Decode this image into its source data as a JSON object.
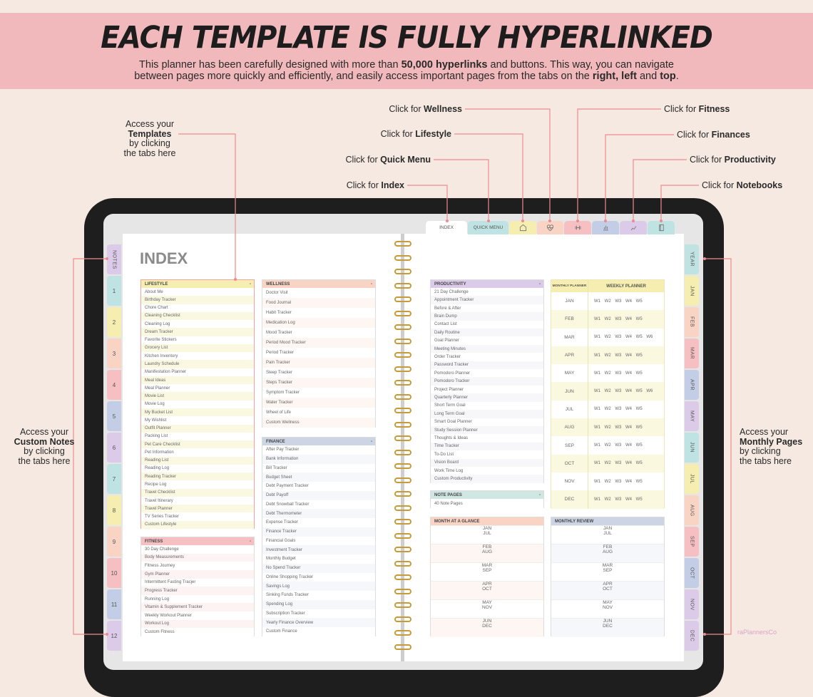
{
  "banner": {
    "title": "EACH TEMPLATE IS FULLY HYPERLINKED",
    "line1_a": "This planner has been carefully designed with more than ",
    "line1_b": "50,000 hyperlinks",
    "line1_c": " and buttons. This way, you can navigate",
    "line2_a": "between pages more quickly and efficiently, and easily access important pages from the tabs on the ",
    "line2_b": "right, left",
    "line2_c": " and ",
    "line2_d": "top",
    "line2_e": "."
  },
  "callouts": {
    "wellness": {
      "pre": "Click for ",
      "bold": "Wellness"
    },
    "lifestyle": {
      "pre": "Click for ",
      "bold": "Lifestyle"
    },
    "quick": {
      "pre": "Click for ",
      "bold": "Quick Menu"
    },
    "index": {
      "pre": "Click for ",
      "bold": "Index"
    },
    "fitness": {
      "pre": "Click for ",
      "bold": "Fitness"
    },
    "finances": {
      "pre": "Click for ",
      "bold": "Finances"
    },
    "productivity": {
      "pre": "Click for ",
      "bold": "Productivity"
    },
    "notebooks": {
      "pre": "Click for ",
      "bold": "Notebooks"
    },
    "templates": {
      "l1": "Access your",
      "bold": "Templates",
      "l3": "by clicking",
      "l4": "the tabs here"
    },
    "notes": {
      "l1": "Access your",
      "bold": "Custom Notes",
      "l3": "by clicking",
      "l4": "the tabs here"
    },
    "monthly": {
      "l1": "Access your",
      "bold": "Monthly Pages",
      "l3": "by clicking",
      "l4": "the tabs here"
    }
  },
  "accent": "#f08a8e",
  "top_tabs": [
    {
      "label": "INDEX",
      "color": "#ffffff"
    },
    {
      "label": "QUICK MENU",
      "color": "#bfe3e3"
    },
    {
      "icon": "home-icon",
      "color": "#f5eeb0"
    },
    {
      "icon": "heart-pulse-icon",
      "color": "#f9d3c3"
    },
    {
      "icon": "dumbbell-icon",
      "color": "#f6c0c3"
    },
    {
      "icon": "finance-icon",
      "color": "#c4cde6"
    },
    {
      "icon": "productivity-icon",
      "color": "#dccbe8"
    },
    {
      "icon": "notebook-icon",
      "color": "#bfe3e3"
    }
  ],
  "left_tabs": [
    "NOTES",
    "1",
    "2",
    "3",
    "4",
    "5",
    "6",
    "7",
    "8",
    "9",
    "10",
    "11",
    "12"
  ],
  "right_tabs": [
    "YEAR",
    "JAN",
    "FEB",
    "MAR",
    "APR",
    "MAY",
    "JUN",
    "JUL",
    "AUG",
    "SEP",
    "OCT",
    "NOV",
    "DEC"
  ],
  "tab_colors": [
    "#dccbe8",
    "#bfe3e3",
    "#f5eeb0",
    "#f9d3c3",
    "#f6c0c3",
    "#c4cde6",
    "#dccbe8",
    "#bfe3e3",
    "#f5eeb0",
    "#f9d3c3",
    "#f6c0c3",
    "#c4cde6",
    "#dccbe8"
  ],
  "page_title": "INDEX",
  "sections": {
    "lifestyle": {
      "title": "LIFESTYLE",
      "color": "#f5eeb0",
      "alt": "#fbf8e2",
      "items": [
        "About Me",
        "Birthday Tracker",
        "Chore Chart",
        "Cleaning Checklist",
        "Cleaning Log",
        "Dream Tracker",
        "Favorite Stickers",
        "Grocery List",
        "Kitchen Inventory",
        "Laundry Schedule",
        "Manifestation Planner",
        "Meal Ideas",
        "Meal Planner",
        "Movie List",
        "Movie Log",
        "My Bucket List",
        "My Wishlist",
        "Outfit Planner",
        "Packing List",
        "Pet Care Checklist",
        "Pet Information",
        "Reading List",
        "Reading Log",
        "Reading Tracker",
        "Recipe Log",
        "Travel Checklist",
        "Travel Itinerary",
        "Travel Planner",
        "TV Series Tracker",
        "Custom Lifestyle"
      ]
    },
    "wellness": {
      "title": "WELLNESS",
      "color": "#f9d3c3",
      "alt": "#fdf6f2",
      "items": [
        "Doctor Visit",
        "Food Journal",
        "Habit Tracker",
        "Medication Log",
        "Mood Tracker",
        "Period Mood Tracker",
        "Period Tracker",
        "Pain Tracker",
        "Sleep Tracker",
        "Steps Tracker",
        "Symptom Tracker",
        "Water Tracker",
        "Wheel of Life",
        "Custom Wellness"
      ]
    },
    "finance": {
      "title": "FINANCE",
      "color": "#cdd5e4",
      "alt": "#f5f7fa",
      "items": [
        "After Pay Tracker",
        "Bank Information",
        "Bill Tracker",
        "Budget Sheet",
        "Debt Payment Tracker",
        "Debt Payoff",
        "Debt Snowball Tracker",
        "Debt Thermometer",
        "Expense Tracker",
        "Finance Tracker",
        "Financial Goals",
        "Investment Tracker",
        "Monthly Budget",
        "No Spend Tracker",
        "Online Shopping Tracker",
        "Savings Log",
        "Sinking Funds Tracker",
        "Spending Log",
        "Subscription Tracker",
        "Yearly Finance Overview",
        "Custom Finance"
      ]
    },
    "fitness": {
      "title": "FITNESS",
      "color": "#f6c0c3",
      "alt": "#fdf3f3",
      "items": [
        "30 Day Challenge",
        "Body Measurements",
        "Fitness Journey",
        "Gym Planner",
        "Intermittent Fasting Tracjer",
        "Progress Tracker",
        "Running Log",
        "Vitamin & Supplement Tracker",
        "Weekly Workout Planner",
        "Workout Log",
        "Custom Fitness"
      ]
    },
    "productivity": {
      "title": "PRODUCTIVITY",
      "color": "#dccbe8",
      "alt": "#f7f6f9",
      "items": [
        "21 Day Challenge",
        "Appointment Tracker",
        "Before & After",
        "Brain Dump",
        "Contact List",
        "Daily Routine",
        "Goal Planner",
        "Meeting Minutes",
        "Order Tracker",
        "Password Tracker",
        "Pomodoro Planner",
        "Pomodoro Tracker",
        "Project Planner",
        "Quarterly Planner",
        "Short Term Goal",
        "Long Term Goal",
        "Smart Goal Planner",
        "Study Session Planner",
        "Thoughts & Ideas",
        "Time Tracker",
        "To-Do List",
        "Vision Board",
        "Work Time Log",
        "Custom Productivity"
      ]
    },
    "notes": {
      "title": "NOTE PAGES",
      "color": "#cfe6e3",
      "alt": "#ffffff",
      "items": [
        "40 Note Pages"
      ]
    }
  },
  "planner": {
    "monthly_header": "MONTHLY PLANNER",
    "weekly_header": "WEEKLY PLANNER",
    "rows": [
      {
        "m": "JAN",
        "w": "W1 W2 W3 W4 W5"
      },
      {
        "m": "FEB",
        "w": "W1 W2 W3 W4 W5"
      },
      {
        "m": "MAR",
        "w": "W1 W2 W3 W4 W5 W6"
      },
      {
        "m": "APR",
        "w": "W1 W2 W3 W4 W5"
      },
      {
        "m": "MAY",
        "w": "W1 W2 W3 W4 W5"
      },
      {
        "m": "JUN",
        "w": "W1 W2 W3 W4 W5 W6"
      },
      {
        "m": "JUL",
        "w": "W1 W2 W3 W4 W5"
      },
      {
        "m": "AUG",
        "w": "W1 W2 W3 W4 W5"
      },
      {
        "m": "SEP",
        "w": "W1 W2 W3 W4 W5"
      },
      {
        "m": "OCT",
        "w": "W1 W2 W3 W4 W5"
      },
      {
        "m": "NOV",
        "w": "W1 W2 W3 W4 W5"
      },
      {
        "m": "DEC",
        "w": "W1 W2 W3 W4 W5"
      }
    ]
  },
  "glance": {
    "title": "MONTH AT A GLANCE",
    "color": "#f9d3c3",
    "alt": "#fdf6f2",
    "pairs": [
      [
        "JAN",
        "JUL"
      ],
      [
        "FEB",
        "AUG"
      ],
      [
        "MAR",
        "SEP"
      ],
      [
        "APR",
        "OCT"
      ],
      [
        "MAY",
        "NOV"
      ],
      [
        "JUN",
        "DEC"
      ]
    ]
  },
  "review": {
    "title": "MONTHLY REVIEW",
    "color": "#cdd5e4",
    "alt": "#f5f7fa",
    "pairs": [
      [
        "JAN",
        "JUL"
      ],
      [
        "FEB",
        "AUG"
      ],
      [
        "MAR",
        "SEP"
      ],
      [
        "APR",
        "OCT"
      ],
      [
        "MAY",
        "NOV"
      ],
      [
        "JUN",
        "DEC"
      ]
    ]
  },
  "logo": "raPlannersCo"
}
